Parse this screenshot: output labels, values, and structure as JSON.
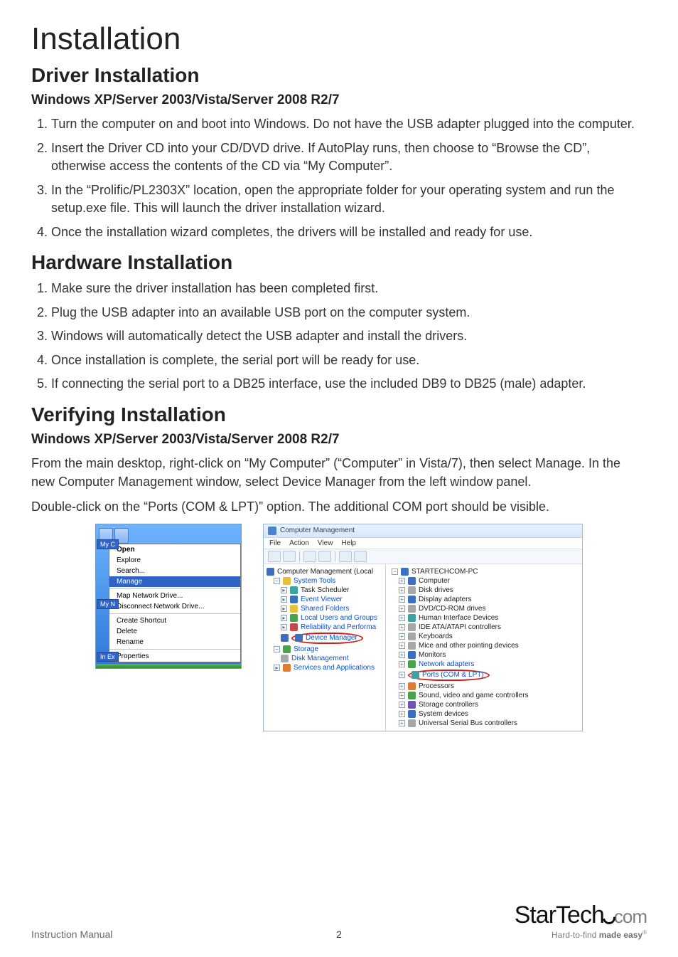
{
  "page_title": "Installation",
  "page_number": "2",
  "footer_left": "Instruction Manual",
  "logo": {
    "part1": "Star",
    "part2": "Tech",
    "part3": "com",
    "tagline_a": "Hard-to-find ",
    "tagline_b": "made easy"
  },
  "sections": {
    "driver": {
      "heading": "Driver Installation",
      "subheading": "Windows XP/Server 2003/Vista/Server 2008 R2/7",
      "steps": [
        "Turn the computer on and boot into Windows.  Do not have the USB adapter plugged into the computer.",
        "Insert the Driver CD into your CD/DVD drive. If AutoPlay runs, then choose to “Browse the CD”, otherwise access the contents of the CD via “My Computer”.",
        "In the “Prolific/PL2303X” location, open the appropriate folder for your operating system and run the setup.exe file. This will launch the driver installation wizard.",
        "Once the installation wizard completes, the drivers will be installed and ready for use."
      ]
    },
    "hardware": {
      "heading": "Hardware Installation",
      "steps": [
        "Make sure the driver installation has been completed first.",
        "Plug the USB adapter into an available USB port on the computer system.",
        "Windows will automatically detect the USB adapter and install the drivers.",
        "Once installation is complete, the serial port will be ready for use.",
        "If connecting the serial port to a DB25 interface, use the included DB9 to DB25 (male) adapter."
      ]
    },
    "verify": {
      "heading": "Verifying Installation",
      "subheading": "Windows XP/Server 2003/Vista/Server 2008 R2/7",
      "para1": "From the main desktop, right-click on “My Computer” (“Computer” in Vista/7), then select Manage. In the new Computer Management window, select Device Manager from the left window panel.",
      "para2": "Double-click on the “Ports (COM & LPT)” option. The additional COM port should be visible."
    }
  },
  "context_menu": {
    "side_myc": "My C",
    "side_myn": "My N",
    "side_ie": "In\nEx",
    "items": [
      {
        "label": "Open",
        "bold": true
      },
      {
        "label": "Explore"
      },
      {
        "label": "Search..."
      },
      {
        "label": "Manage",
        "highlight": true
      },
      {
        "sep": true
      },
      {
        "label": "Map Network Drive..."
      },
      {
        "label": "Disconnect Network Drive..."
      },
      {
        "sep": true
      },
      {
        "label": "Create Shortcut"
      },
      {
        "label": "Delete"
      },
      {
        "label": "Rename"
      },
      {
        "sep": true
      },
      {
        "label": "Properties"
      }
    ]
  },
  "cm": {
    "title": "Computer Management",
    "menu": [
      "File",
      "Action",
      "View",
      "Help"
    ],
    "tree": [
      {
        "label": "Computer Management (Local",
        "depth": 0,
        "icon": "c-blue",
        "link": false
      },
      {
        "label": "System Tools",
        "depth": 1,
        "icon": "c-yellow",
        "link": true,
        "exp": "-"
      },
      {
        "label": "Task Scheduler",
        "depth": 2,
        "icon": "c-teal",
        "link": false,
        "exp": ">"
      },
      {
        "label": "Event Viewer",
        "depth": 2,
        "icon": "c-blue",
        "link": true,
        "exp": ">"
      },
      {
        "label": "Shared Folders",
        "depth": 2,
        "icon": "c-yellow",
        "link": true,
        "exp": ">"
      },
      {
        "label": "Local Users and Groups",
        "depth": 2,
        "icon": "c-green",
        "link": true,
        "exp": ">"
      },
      {
        "label": "Reliability and Performa",
        "depth": 2,
        "icon": "c-red",
        "link": true,
        "exp": ">"
      },
      {
        "label": "Device Manager",
        "depth": 2,
        "icon": "c-blue",
        "link": true,
        "circle": true
      },
      {
        "label": "Storage",
        "depth": 1,
        "icon": "c-green",
        "link": true,
        "exp": "-"
      },
      {
        "label": "Disk Management",
        "depth": 2,
        "icon": "c-grey",
        "link": true
      },
      {
        "label": "Services and Applications",
        "depth": 1,
        "icon": "c-orange",
        "link": true,
        "exp": ">"
      }
    ],
    "devices": [
      {
        "label": "STARTECHCOM-PC",
        "icon": "c-blue",
        "exp": "-"
      },
      {
        "label": "Computer",
        "icon": "c-blue",
        "exp": "+"
      },
      {
        "label": "Disk drives",
        "icon": "c-grey",
        "exp": "+"
      },
      {
        "label": "Display adapters",
        "icon": "c-blue",
        "exp": "+"
      },
      {
        "label": "DVD/CD-ROM drives",
        "icon": "c-grey",
        "exp": "+"
      },
      {
        "label": "Human Interface Devices",
        "icon": "c-teal",
        "exp": "+"
      },
      {
        "label": "IDE ATA/ATAPI controllers",
        "icon": "c-grey",
        "exp": "+"
      },
      {
        "label": "Keyboards",
        "icon": "c-grey",
        "exp": "+"
      },
      {
        "label": "Mice and other pointing devices",
        "icon": "c-grey",
        "exp": "+"
      },
      {
        "label": "Monitors",
        "icon": "c-blue",
        "exp": "+"
      },
      {
        "label": "Network adapters",
        "icon": "c-green",
        "exp": "+",
        "link": true
      },
      {
        "label": "Ports (COM & LPT)",
        "icon": "c-teal",
        "exp": "+",
        "link": true,
        "circle": true
      },
      {
        "label": "Processors",
        "icon": "c-orange",
        "exp": "+"
      },
      {
        "label": "Sound, video and game controllers",
        "icon": "c-green",
        "exp": "+"
      },
      {
        "label": "Storage controllers",
        "icon": "c-purple",
        "exp": "+"
      },
      {
        "label": "System devices",
        "icon": "c-blue",
        "exp": "+"
      },
      {
        "label": "Universal Serial Bus controllers",
        "icon": "c-grey",
        "exp": "+"
      }
    ]
  }
}
